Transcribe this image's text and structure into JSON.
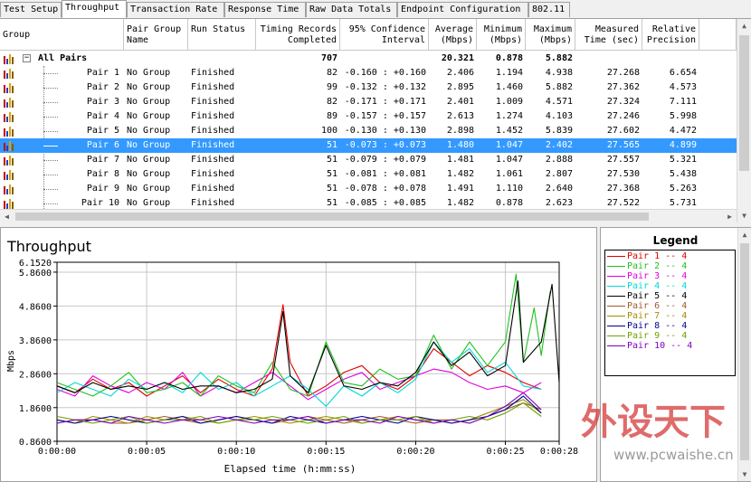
{
  "tabs": [
    "Test Setup",
    "Throughput",
    "Transaction Rate",
    "Response Time",
    "Raw Data Totals",
    "Endpoint Configuration",
    "802.11"
  ],
  "active_tab": "Throughput",
  "columns": [
    "Group",
    "Pair Group\nName",
    "Run Status",
    "Timing Records\nCompleted",
    "95% Confidence\nInterval",
    "Average\n(Mbps)",
    "Minimum\n(Mbps)",
    "Maximum\n(Mbps)",
    "Measured\nTime (sec)",
    "Relative\nPrecision"
  ],
  "summary_row": {
    "group": "All Pairs",
    "expander": "−",
    "records": "707",
    "average": "20.321",
    "minimum": "0.878",
    "maximum": "5.882"
  },
  "rows": [
    {
      "pair": "Pair 1",
      "group": "No Group",
      "status": "Finished",
      "records": "82",
      "ci": "-0.160 : +0.160",
      "avg": "2.406",
      "min": "1.194",
      "max": "4.938",
      "time": "27.268",
      "prec": "6.654"
    },
    {
      "pair": "Pair 2",
      "group": "No Group",
      "status": "Finished",
      "records": "99",
      "ci": "-0.132 : +0.132",
      "avg": "2.895",
      "min": "1.460",
      "max": "5.882",
      "time": "27.362",
      "prec": "4.573"
    },
    {
      "pair": "Pair 3",
      "group": "No Group",
      "status": "Finished",
      "records": "82",
      "ci": "-0.171 : +0.171",
      "avg": "2.401",
      "min": "1.009",
      "max": "4.571",
      "time": "27.324",
      "prec": "7.111"
    },
    {
      "pair": "Pair 4",
      "group": "No Group",
      "status": "Finished",
      "records": "89",
      "ci": "-0.157 : +0.157",
      "avg": "2.613",
      "min": "1.274",
      "max": "4.103",
      "time": "27.246",
      "prec": "5.998"
    },
    {
      "pair": "Pair 5",
      "group": "No Group",
      "status": "Finished",
      "records": "100",
      "ci": "-0.130 : +0.130",
      "avg": "2.898",
      "min": "1.452",
      "max": "5.839",
      "time": "27.602",
      "prec": "4.472"
    },
    {
      "pair": "Pair 6",
      "group": "No Group",
      "status": "Finished",
      "records": "51",
      "ci": "-0.073 : +0.073",
      "avg": "1.480",
      "min": "1.047",
      "max": "2.402",
      "time": "27.565",
      "prec": "4.899"
    },
    {
      "pair": "Pair 7",
      "group": "No Group",
      "status": "Finished",
      "records": "51",
      "ci": "-0.079 : +0.079",
      "avg": "1.481",
      "min": "1.047",
      "max": "2.888",
      "time": "27.557",
      "prec": "5.321"
    },
    {
      "pair": "Pair 8",
      "group": "No Group",
      "status": "Finished",
      "records": "51",
      "ci": "-0.081 : +0.081",
      "avg": "1.482",
      "min": "1.061",
      "max": "2.807",
      "time": "27.530",
      "prec": "5.438"
    },
    {
      "pair": "Pair 9",
      "group": "No Group",
      "status": "Finished",
      "records": "51",
      "ci": "-0.078 : +0.078",
      "avg": "1.491",
      "min": "1.110",
      "max": "2.640",
      "time": "27.368",
      "prec": "5.263"
    },
    {
      "pair": "Pair 10",
      "group": "No Group",
      "status": "Finished",
      "records": "51",
      "ci": "-0.085 : +0.085",
      "avg": "1.482",
      "min": "0.878",
      "max": "2.623",
      "time": "27.522",
      "prec": "5.731"
    }
  ],
  "selected_row": 5,
  "chart_title": "Throughput",
  "legend_title": "Legend",
  "legend": [
    {
      "label": "Pair 1 -- 4",
      "color": "#e00000"
    },
    {
      "label": "Pair 2 -- 4",
      "color": "#20c020"
    },
    {
      "label": "Pair 3 -- 4",
      "color": "#e000e0"
    },
    {
      "label": "Pair 4 -- 4",
      "color": "#00d8d8"
    },
    {
      "label": "Pair 5 -- 4",
      "color": "#000000"
    },
    {
      "label": "Pair 6 -- 4",
      "color": "#a05a2c"
    },
    {
      "label": "Pair 7 -- 4",
      "color": "#a09000"
    },
    {
      "label": "Pair 8 -- 4",
      "color": "#000090"
    },
    {
      "label": "Pair 9 -- 4",
      "color": "#70a000"
    },
    {
      "label": "Pair 10 -- 4",
      "color": "#8000c0"
    }
  ],
  "watermark": {
    "text": "外设天下",
    "url": "www.pcwaishe.cn"
  },
  "chart_data": {
    "type": "line",
    "title": "Throughput",
    "xlabel": "Elapsed time (h:mm:ss)",
    "ylabel": "Mbps",
    "ylim": [
      0.866,
      6.152
    ],
    "xlim": [
      0,
      28
    ],
    "y_ticks": [
      "6.1520",
      "5.8600",
      "4.8600",
      "3.8600",
      "2.8600",
      "1.8600",
      "0.8600"
    ],
    "y_tick_values": [
      6.152,
      5.86,
      4.86,
      3.86,
      2.86,
      1.86,
      0.866
    ],
    "x_ticks": [
      "0:00:00",
      "0:00:05",
      "0:00:10",
      "0:00:15",
      "0:00:20",
      "0:00:25",
      "0:00:28"
    ],
    "x_tick_values": [
      0,
      5,
      10,
      15,
      20,
      25,
      28
    ],
    "grid": true,
    "series": [
      {
        "name": "Pair 1 -- 4",
        "color": "#e00000",
        "x": [
          0,
          1,
          2,
          3,
          4,
          5,
          6,
          7,
          8,
          9,
          10,
          11,
          12,
          12.6,
          13,
          14,
          15,
          16,
          17,
          18,
          19,
          20,
          21,
          22,
          23,
          24,
          25,
          26,
          27
        ],
        "y": [
          2.5,
          2.3,
          2.7,
          2.4,
          2.6,
          2.2,
          2.5,
          2.8,
          2.3,
          2.7,
          2.4,
          2.2,
          3.0,
          4.9,
          3.2,
          2.2,
          2.5,
          2.9,
          3.1,
          2.6,
          2.4,
          2.8,
          3.6,
          3.2,
          2.8,
          3.1,
          2.9,
          2.6,
          2.4
        ]
      },
      {
        "name": "Pair 2 -- 4",
        "color": "#20c020",
        "x": [
          0,
          1,
          2,
          3,
          4,
          5,
          6,
          7,
          8,
          9,
          10,
          11,
          12,
          13,
          14,
          15,
          16,
          17,
          18,
          19,
          20,
          21,
          22,
          23,
          24,
          25,
          25.6,
          26,
          26.6,
          27,
          27.5
        ],
        "y": [
          2.6,
          2.4,
          2.2,
          2.5,
          2.9,
          2.3,
          2.4,
          2.6,
          2.2,
          2.8,
          2.5,
          2.3,
          3.2,
          2.4,
          2.2,
          3.8,
          2.6,
          2.5,
          3.0,
          2.7,
          2.8,
          4.0,
          3.0,
          3.8,
          3.1,
          3.8,
          5.8,
          3.2,
          4.8,
          3.4,
          5.3
        ]
      },
      {
        "name": "Pair 3 -- 4",
        "color": "#e000e0",
        "x": [
          0,
          1,
          2,
          3,
          4,
          5,
          6,
          7,
          8,
          9,
          10,
          11,
          12,
          13,
          14,
          15,
          16,
          17,
          18,
          19,
          20,
          21,
          22,
          23,
          24,
          25,
          26,
          27
        ],
        "y": [
          2.4,
          2.2,
          2.8,
          2.5,
          2.3,
          2.6,
          2.4,
          2.9,
          2.2,
          2.5,
          2.3,
          2.6,
          2.9,
          2.5,
          2.1,
          2.4,
          2.7,
          2.9,
          2.4,
          2.6,
          2.8,
          3.0,
          2.9,
          2.6,
          2.4,
          2.5,
          2.3,
          2.6
        ]
      },
      {
        "name": "Pair 4 -- 4",
        "color": "#00d8d8",
        "x": [
          0,
          1,
          2,
          3,
          4,
          5,
          6,
          7,
          8,
          9,
          10,
          11,
          12,
          13,
          14,
          15,
          16,
          17,
          18,
          19,
          20,
          21,
          22,
          23,
          24,
          25,
          26,
          27
        ],
        "y": [
          2.3,
          2.6,
          2.4,
          2.2,
          2.7,
          2.4,
          2.6,
          2.3,
          2.9,
          2.4,
          2.6,
          2.2,
          2.5,
          2.8,
          2.4,
          1.9,
          2.5,
          2.2,
          2.6,
          2.3,
          2.7,
          3.8,
          3.2,
          3.6,
          2.9,
          3.2,
          2.5,
          2.4
        ]
      },
      {
        "name": "Pair 5 -- 4",
        "color": "#000000",
        "x": [
          0,
          1,
          2,
          3,
          4,
          5,
          6,
          7,
          8,
          9,
          10,
          11,
          12,
          12.6,
          13,
          14,
          15,
          16,
          17,
          18,
          19,
          20,
          21,
          22,
          23,
          24,
          25,
          25.7,
          26,
          27,
          27.6,
          28
        ],
        "y": [
          2.5,
          2.3,
          2.6,
          2.4,
          2.5,
          2.4,
          2.6,
          2.4,
          2.5,
          2.5,
          2.3,
          2.4,
          2.7,
          4.7,
          2.8,
          2.3,
          3.7,
          2.5,
          2.4,
          2.6,
          2.5,
          2.9,
          3.8,
          3.1,
          3.5,
          2.8,
          3.1,
          5.6,
          3.2,
          3.8,
          5.5,
          2.6
        ]
      },
      {
        "name": "Pair 6 -- 4",
        "color": "#a05a2c",
        "x": [
          0,
          1,
          2,
          3,
          4,
          5,
          6,
          7,
          8,
          9,
          10,
          11,
          12,
          13,
          14,
          15,
          16,
          17,
          18,
          19,
          20,
          21,
          22,
          23,
          24,
          25,
          26,
          27
        ],
        "y": [
          1.4,
          1.5,
          1.5,
          1.4,
          1.4,
          1.5,
          1.6,
          1.5,
          1.4,
          1.5,
          1.6,
          1.5,
          1.4,
          1.5,
          1.6,
          1.5,
          1.4,
          1.5,
          1.6,
          1.5,
          1.4,
          1.5,
          1.5,
          1.4,
          1.6,
          1.8,
          2.0,
          1.8
        ]
      },
      {
        "name": "Pair 7 -- 4",
        "color": "#a09000",
        "x": [
          0,
          1,
          2,
          3,
          4,
          5,
          6,
          7,
          8,
          9,
          10,
          11,
          12,
          13,
          14,
          15,
          16,
          17,
          18,
          19,
          20,
          21,
          22,
          23,
          24,
          25,
          26,
          27
        ],
        "y": [
          1.5,
          1.4,
          1.6,
          1.5,
          1.4,
          1.6,
          1.5,
          1.6,
          1.5,
          1.4,
          1.5,
          1.6,
          1.5,
          1.4,
          1.5,
          1.6,
          1.5,
          1.4,
          1.5,
          1.6,
          1.5,
          1.5,
          1.4,
          1.5,
          1.7,
          1.9,
          2.1,
          1.7
        ]
      },
      {
        "name": "Pair 8 -- 4",
        "color": "#000090",
        "x": [
          0,
          1,
          2,
          3,
          4,
          5,
          6,
          7,
          8,
          9,
          10,
          11,
          12,
          13,
          14,
          15,
          16,
          17,
          18,
          19,
          20,
          21,
          22,
          23,
          24,
          25,
          26,
          27
        ],
        "y": [
          1.5,
          1.4,
          1.5,
          1.6,
          1.5,
          1.4,
          1.5,
          1.6,
          1.4,
          1.5,
          1.6,
          1.5,
          1.4,
          1.6,
          1.5,
          1.4,
          1.5,
          1.6,
          1.5,
          1.4,
          1.6,
          1.5,
          1.4,
          1.5,
          1.6,
          1.8,
          2.2,
          1.7
        ]
      },
      {
        "name": "Pair 9 -- 4",
        "color": "#70a000",
        "x": [
          0,
          1,
          2,
          3,
          4,
          5,
          6,
          7,
          8,
          9,
          10,
          11,
          12,
          13,
          14,
          15,
          16,
          17,
          18,
          19,
          20,
          21,
          22,
          23,
          24,
          25,
          26,
          27
        ],
        "y": [
          1.6,
          1.5,
          1.4,
          1.5,
          1.6,
          1.4,
          1.5,
          1.5,
          1.6,
          1.4,
          1.5,
          1.5,
          1.6,
          1.5,
          1.4,
          1.5,
          1.6,
          1.4,
          1.5,
          1.5,
          1.6,
          1.4,
          1.5,
          1.6,
          1.5,
          1.7,
          2.0,
          1.6
        ]
      },
      {
        "name": "Pair 10 -- 4",
        "color": "#8000c0",
        "x": [
          0,
          1,
          2,
          3,
          4,
          5,
          6,
          7,
          8,
          9,
          10,
          11,
          12,
          13,
          14,
          15,
          16,
          17,
          18,
          19,
          20,
          21,
          22,
          23,
          24,
          25,
          26,
          27
        ],
        "y": [
          1.4,
          1.5,
          1.5,
          1.4,
          1.6,
          1.5,
          1.4,
          1.5,
          1.5,
          1.6,
          1.5,
          1.4,
          1.5,
          1.5,
          1.6,
          1.4,
          1.5,
          1.5,
          1.4,
          1.6,
          1.5,
          1.4,
          1.5,
          1.4,
          1.6,
          1.9,
          2.3,
          1.8
        ]
      }
    ]
  }
}
